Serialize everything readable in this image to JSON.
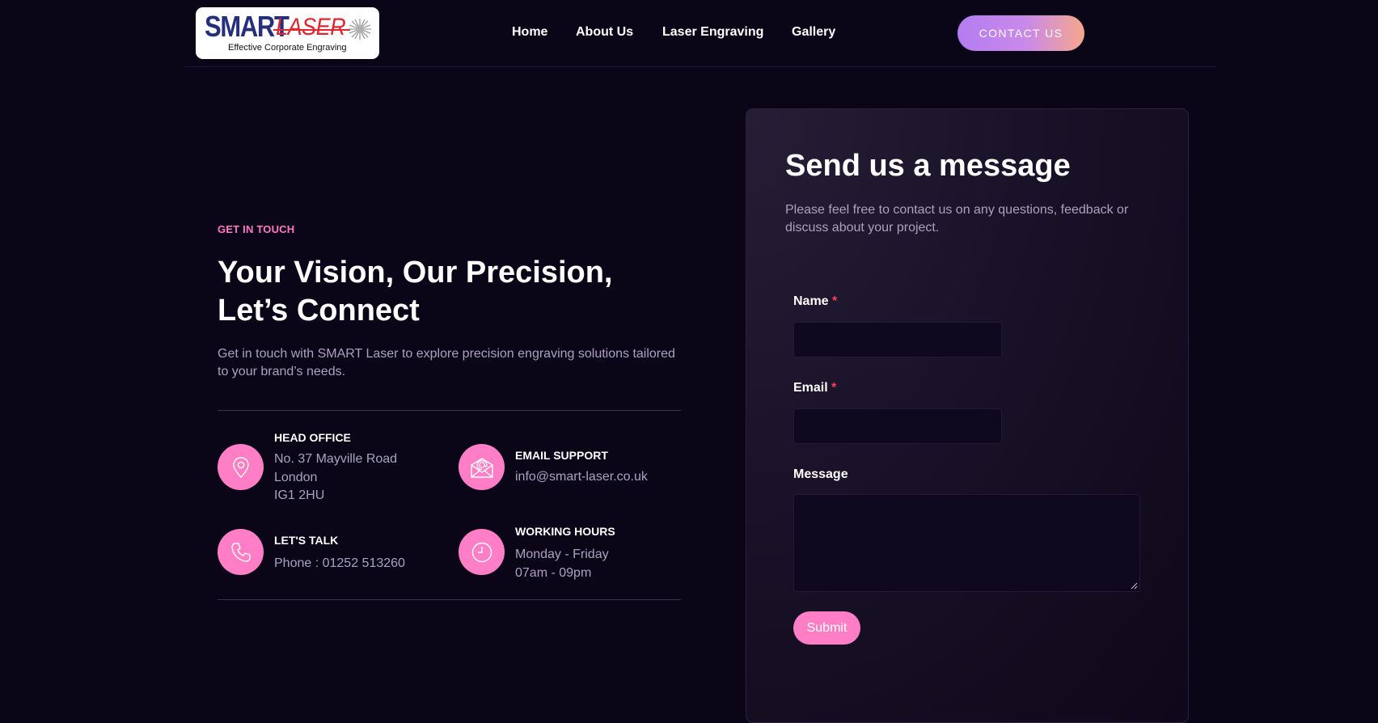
{
  "brand": {
    "logo_word_1": "SMART",
    "logo_word_2": "LASER",
    "tagline": "Effective Corporate Engraving",
    "colors": {
      "navy": "#26307a",
      "red": "#e0262e"
    }
  },
  "nav": {
    "items": [
      {
        "label": "Home"
      },
      {
        "label": "About Us"
      },
      {
        "label": "Laser Engraving"
      },
      {
        "label": "Gallery"
      }
    ],
    "cta_label": "CONTACT US"
  },
  "hero": {
    "eyebrow": "GET IN TOUCH",
    "title_line_1": "Your Vision, Our Precision,",
    "title_line_2": "Let’s Connect",
    "description_line_1": "Get in touch with SMART Laser to explore precision engraving solutions tailored",
    "description_line_2": "to your brand’s needs."
  },
  "contact_info": [
    {
      "icon": "map-pin-icon",
      "title": "HEAD OFFICE",
      "lines": [
        "No. 37 Mayville Road",
        "London",
        "IG1 2HU"
      ]
    },
    {
      "icon": "email-icon",
      "title": "EMAIL SUPPORT",
      "lines": [
        "info@smart-laser.co.uk"
      ]
    },
    {
      "icon": "phone-icon",
      "title": "LET'S TALK",
      "lines": [
        "Phone : 01252 513260"
      ]
    },
    {
      "icon": "clock-icon",
      "title": "WORKING HOURS",
      "lines": [
        "Monday - Friday",
        "07am - 09pm"
      ]
    }
  ],
  "form": {
    "title": "Send us a message",
    "description_line_1": "Please feel free to contact us on any questions, feedback or",
    "description_line_2": "discuss about your project.",
    "fields": {
      "name": {
        "label": "Name",
        "required_mark": "*",
        "value": ""
      },
      "email": {
        "label": "Email",
        "required_mark": "*",
        "value": ""
      },
      "message": {
        "label": "Message",
        "value": ""
      }
    },
    "submit_label": "Submit"
  },
  "colors": {
    "background": "#0b0518",
    "accent_pink": "#ff7ec6",
    "eyebrow_pink": "#ff7ac4",
    "required_red": "#ff3b5c",
    "muted_text": "#aaa2bf",
    "cta_gradient_start": "#b47cf2",
    "cta_gradient_end": "#f7a68c"
  }
}
